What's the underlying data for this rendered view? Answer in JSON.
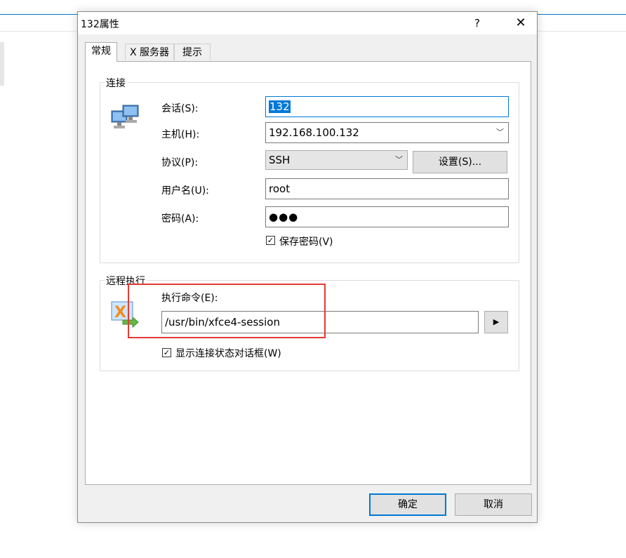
{
  "dialog": {
    "title": "132属性",
    "help": "?",
    "close": "✕"
  },
  "tabs": [
    "常规",
    "X 服务器",
    "提示"
  ],
  "connection": {
    "group_label": "连接",
    "session_label": "会话(S):",
    "session_value": "132",
    "host_label": "主机(H):",
    "host_value": "192.168.100.132",
    "protocol_label": "协议(P):",
    "protocol_value": "SSH",
    "settings_button": "设置(S)...",
    "username_label": "用户名(U):",
    "username_value": "root",
    "password_label": "密码(A):",
    "password_value": "●●●",
    "save_password_label": "保存密码(V)",
    "save_password_checked": true
  },
  "remote_exec": {
    "group_label": "远程执行",
    "command_label": "执行命令(E):",
    "command_value": "/usr/bin/xfce4-session",
    "run_button": "▶",
    "show_status_label": "显示连接状态对话框(W)",
    "show_status_checked": true
  },
  "footer": {
    "ok": "确定",
    "cancel": "取消"
  },
  "colors": {
    "accent": "#0078d7",
    "highlight": "#e53935"
  }
}
